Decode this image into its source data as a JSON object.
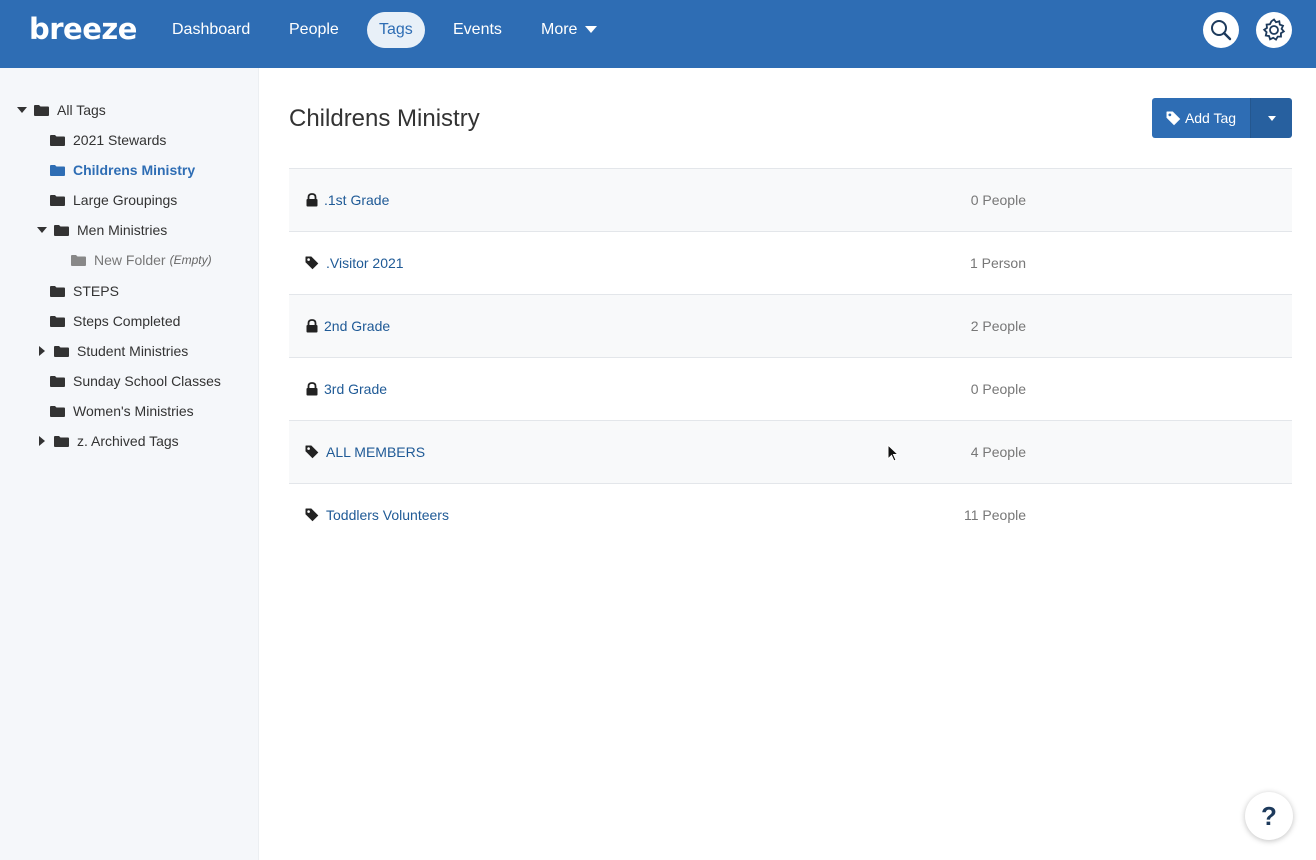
{
  "nav": {
    "logo": "breeze",
    "items": [
      {
        "label": "Dashboard"
      },
      {
        "label": "People"
      },
      {
        "label": "Tags"
      },
      {
        "label": "Events"
      },
      {
        "label": "More"
      }
    ],
    "active": "Tags",
    "accent": "#2e6db4"
  },
  "sidebar": {
    "root": "All Tags",
    "items": [
      {
        "label": "2021 Stewards"
      },
      {
        "label": "Childrens Ministry",
        "selected": true
      },
      {
        "label": "Large Groupings"
      },
      {
        "label": "Men Ministries",
        "expanded": true
      },
      {
        "label": "New Folder",
        "note": "(Empty)"
      },
      {
        "label": "STEPS"
      },
      {
        "label": "Steps Completed"
      },
      {
        "label": "Student Ministries",
        "collapsed": true
      },
      {
        "label": "Sunday School Classes"
      },
      {
        "label": "Women's Ministries"
      },
      {
        "label": "z. Archived Tags",
        "collapsed": true
      }
    ]
  },
  "main": {
    "title": "Childrens Ministry",
    "add_tag_label": "Add Tag",
    "tags": [
      {
        "icon": "lock-icon",
        "name": ".1st Grade",
        "count": "0 People"
      },
      {
        "icon": "tag-icon",
        "name": ".Visitor 2021",
        "count": "1 Person"
      },
      {
        "icon": "lock-icon",
        "name": "2nd Grade",
        "count": "2 People"
      },
      {
        "icon": "lock-icon",
        "name": "3rd Grade",
        "count": "0 People"
      },
      {
        "icon": "tag-icon",
        "name": "ALL MEMBERS",
        "count": "4 People"
      },
      {
        "icon": "tag-icon",
        "name": "Toddlers Volunteers",
        "count": "11 People"
      }
    ]
  },
  "help": {
    "label": "?"
  }
}
